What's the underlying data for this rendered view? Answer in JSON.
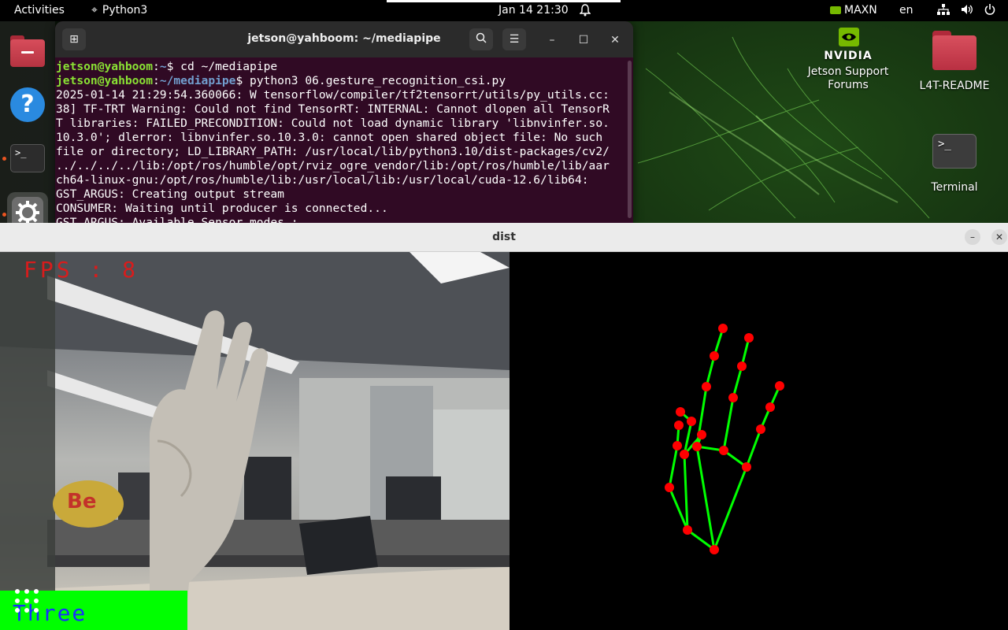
{
  "topbar": {
    "activities": "Activities",
    "app_name": "Python3",
    "datetime": "Jan 14  21:30",
    "power_mode": "MAXN",
    "language": "en"
  },
  "desktop": {
    "icons": [
      {
        "label": "Jetson Support Forums"
      },
      {
        "label": "L4T-README"
      },
      {
        "label": "Terminal"
      }
    ],
    "nvidia_wordmark": "NVIDIA"
  },
  "dock": {
    "items": [
      "files-icon",
      "help-icon",
      "terminal-icon",
      "settings-icon",
      "trash-icon"
    ]
  },
  "terminal": {
    "title": "jetson@yahboom: ~/mediapipe",
    "lines": [
      {
        "user": "jetson@yahboom",
        "path": "~",
        "cmd": "$ cd ~/mediapipe"
      },
      {
        "user": "jetson@yahboom",
        "path": "~/mediapipe",
        "cmd": "$ python3 06.gesture_recognition_csi.py"
      },
      {
        "text": "2025-01-14 21:29:54.360066: W tensorflow/compiler/tf2tensorrt/utils/py_utils.cc:"
      },
      {
        "text": "38] TF-TRT Warning: Could not find TensorRT: INTERNAL: Cannot dlopen all TensorR"
      },
      {
        "text": "T libraries: FAILED_PRECONDITION: Could not load dynamic library 'libnvinfer.so."
      },
      {
        "text": "10.3.0'; dlerror: libnvinfer.so.10.3.0: cannot open shared object file: No such"
      },
      {
        "text": "file or directory; LD_LIBRARY_PATH: /usr/local/lib/python3.10/dist-packages/cv2/"
      },
      {
        "text": "../../../../lib:/opt/ros/humble/opt/rviz_ogre_vendor/lib:/opt/ros/humble/lib/aar"
      },
      {
        "text": "ch64-linux-gnu:/opt/ros/humble/lib:/usr/local/lib:/usr/local/cuda-12.6/lib64:"
      },
      {
        "text": "GST_ARGUS: Creating output stream"
      },
      {
        "text": "CONSUMER: Waiting until producer is connected..."
      },
      {
        "text": "GST_ARGUS: Available Sensor modes :"
      }
    ]
  },
  "dist_window": {
    "title": "dist",
    "fps_text": "FPS : 8",
    "gesture": "Three"
  },
  "colors": {
    "landmark_point": "#ff0000",
    "landmark_line": "#00ff00",
    "gesture_box": "#00ff00",
    "gesture_text": "#1a2cff",
    "terminal_bg": "#300a24",
    "prompt_user": "#8ae234",
    "prompt_path": "#729fcf"
  }
}
